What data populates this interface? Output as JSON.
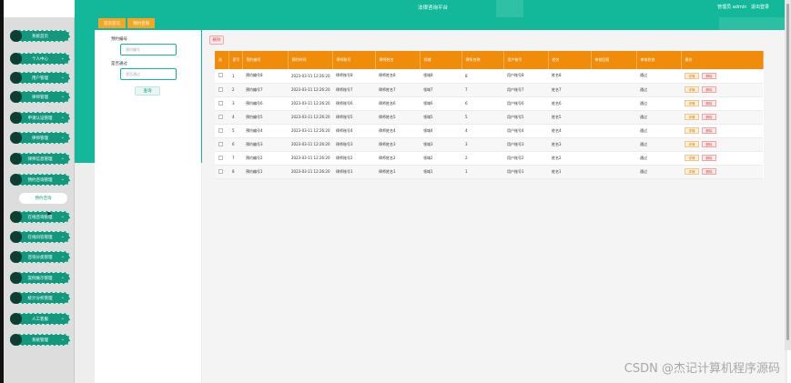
{
  "header": {
    "title": "法律咨询平台",
    "user_label": "管理员 admin",
    "logout_label": "退出登录"
  },
  "breadcrumb": [
    "首页首页",
    "预约咨询"
  ],
  "sidebar": {
    "menu": [
      {
        "label": "系统首页",
        "arrow": false
      },
      {
        "label": "个人中心",
        "arrow": true
      },
      {
        "label": "用户管理",
        "arrow": true
      },
      {
        "label": "律师管理",
        "arrow": true
      },
      {
        "label": "申请认证管理",
        "arrow": true
      },
      {
        "label": "律师管理",
        "arrow": true
      },
      {
        "label": "律师信息管理",
        "arrow": true
      },
      {
        "label": "预约咨询管理",
        "arrow": true
      },
      {
        "label": "在线咨询管理",
        "arrow": true
      },
      {
        "label": "在线问答管理",
        "arrow": true
      },
      {
        "label": "咨询分类管理",
        "arrow": true
      },
      {
        "label": "案例展示管理",
        "arrow": true
      },
      {
        "label": "统计分析管理",
        "arrow": true
      },
      {
        "label": "人工客服",
        "arrow": true
      },
      {
        "label": "系统管理",
        "arrow": true
      }
    ],
    "sub_item": "预约咨询"
  },
  "filters": {
    "order_no_label": "预约编号",
    "order_no_placeholder": "预约编号",
    "status_label": "是否通过",
    "status_placeholder": "是否通过",
    "search_label": "查询"
  },
  "toolbar": {
    "delete_label": "删除"
  },
  "table": {
    "headers": [
      "选",
      "索引",
      "预约编号",
      "预约时间",
      "律师账号",
      "律师姓名",
      "领域",
      "律所名称",
      "用户账号",
      "姓名",
      "审核回复",
      "审核状态",
      "操作"
    ],
    "rows": [
      [
        "1",
        "预约编号8",
        "2023-03-11 12:26:20",
        "律师账号8",
        "律师姓名8",
        "领域8",
        "8",
        "用户账号8",
        "姓名8",
        "",
        "通过"
      ],
      [
        "2",
        "预约编号7",
        "2023-03-11 12:26:20",
        "律师账号7",
        "律师姓名7",
        "领域7",
        "7",
        "用户账号7",
        "姓名7",
        "",
        "通过"
      ],
      [
        "3",
        "预约编号6",
        "2023-03-11 12:26:20",
        "律师账号6",
        "律师姓名6",
        "领域6",
        "6",
        "用户账号6",
        "姓名6",
        "",
        "通过"
      ],
      [
        "4",
        "预约编号5",
        "2023-03-11 12:26:20",
        "律师账号5",
        "律师姓名5",
        "领域5",
        "5",
        "用户账号5",
        "姓名5",
        "",
        "通过"
      ],
      [
        "5",
        "预约编号4",
        "2023-03-11 12:26:20",
        "律师账号4",
        "律师姓名4",
        "领域4",
        "4",
        "用户账号4",
        "姓名4",
        "",
        "通过"
      ],
      [
        "6",
        "预约编号3",
        "2023-03-11 12:26:20",
        "律师账号3",
        "律师姓名3",
        "领域3",
        "3",
        "用户账号3",
        "姓名3",
        "",
        "通过"
      ],
      [
        "7",
        "预约编号2",
        "2023-03-11 12:26:20",
        "律师账号2",
        "律师姓名2",
        "领域2",
        "2",
        "用户账号2",
        "姓名2",
        "",
        "通过"
      ],
      [
        "8",
        "预约编号1",
        "2023-03-11 12:26:20",
        "律师账号1",
        "律师姓名1",
        "领域1",
        "1",
        "用户账号1",
        "姓名1",
        "",
        "通过"
      ]
    ],
    "detail_label": "详情",
    "row_delete_label": "删除"
  },
  "watermark": "CSDN @杰记计算机程序源码",
  "colors": {
    "primary": "#13b89a",
    "header_bg": "#f08c0a",
    "danger": "#e04848"
  }
}
